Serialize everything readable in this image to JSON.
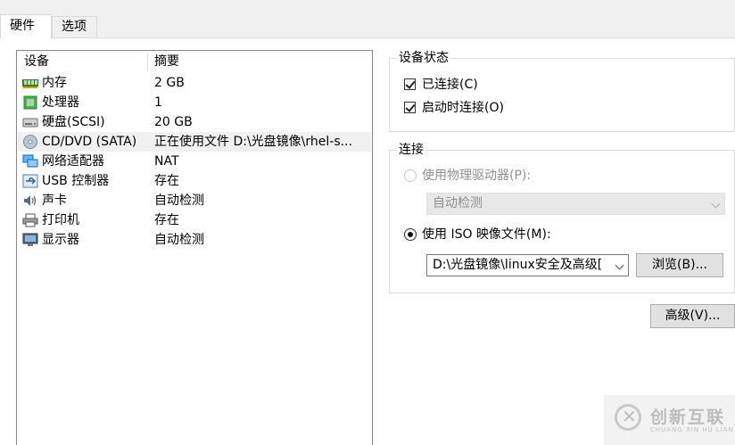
{
  "tabs": [
    {
      "label": "硬件"
    },
    {
      "label": "选项"
    }
  ],
  "device_list": {
    "header_device": "设备",
    "header_summary": "摘要",
    "rows": [
      {
        "name": "内存",
        "summary": "2 GB",
        "icon": "memory-icon"
      },
      {
        "name": "处理器",
        "summary": "1",
        "icon": "processor-icon"
      },
      {
        "name": "硬盘(SCSI)",
        "summary": "20 GB",
        "icon": "hard-disk-icon"
      },
      {
        "name": "CD/DVD (SATA)",
        "summary": "正在使用文件 D:\\光盘镜像\\rhel-s...",
        "icon": "cd-dvd-icon",
        "selected": true
      },
      {
        "name": "网络适配器",
        "summary": "NAT",
        "icon": "network-adapter-icon"
      },
      {
        "name": "USB 控制器",
        "summary": "存在",
        "icon": "usb-icon"
      },
      {
        "name": "声卡",
        "summary": "自动检测",
        "icon": "sound-card-icon"
      },
      {
        "name": "打印机",
        "summary": "存在",
        "icon": "printer-icon"
      },
      {
        "name": "显示器",
        "summary": "自动检测",
        "icon": "display-icon"
      }
    ]
  },
  "device_status": {
    "title": "设备状态",
    "connected": {
      "label": "已连接(C)",
      "checked": true
    },
    "connect_at_power_on": {
      "label": "启动时连接(O)",
      "checked": true
    }
  },
  "connection": {
    "title": "连接",
    "physical_drive": {
      "label": "使用物理驱动器(P):",
      "selected": false,
      "disabled": true
    },
    "physical_drive_select": {
      "value": "自动检测",
      "disabled": true
    },
    "iso_image": {
      "label": "使用 ISO 映像文件(M):",
      "selected": true
    },
    "iso_path": {
      "value": "D:\\光盘镜像\\linux安全及高级[",
      "disabled": false
    },
    "browse_label": "浏览(B)..."
  },
  "advanced_label": "高级(V)...",
  "watermark": {
    "cn": "创新互联",
    "en": "CHUANG XIN HU LIAN"
  },
  "colors": {
    "selected_row": "#f0f0f0",
    "panel": "#ffffff",
    "window": "#f0f0f0"
  }
}
